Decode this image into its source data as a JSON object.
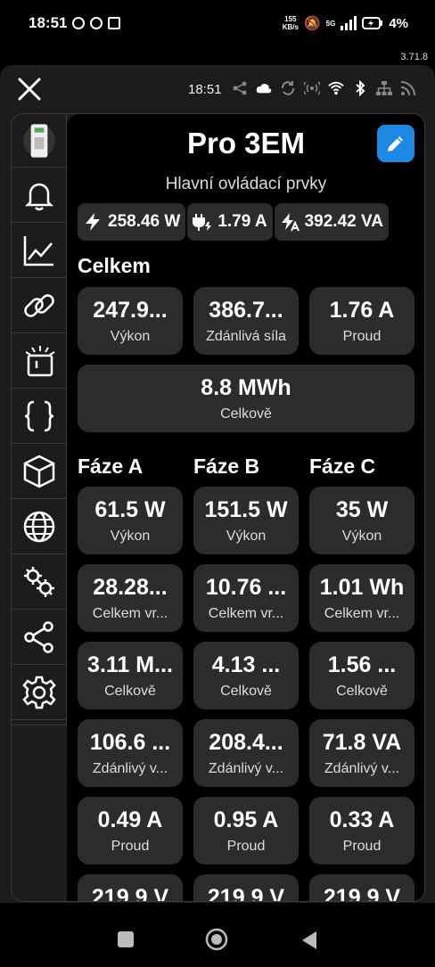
{
  "status": {
    "time": "18:51",
    "net_speed_top": "155",
    "net_speed_bottom": "KB/s",
    "net_type": "5G",
    "battery": "4%"
  },
  "app_version": "3.71.8",
  "topbar": {
    "time": "18:51"
  },
  "device": {
    "title": "Pro 3EM",
    "subtitle": "Hlavní ovládací prvky"
  },
  "chips": [
    {
      "icon": "bolt-icon",
      "value": "258.46 W"
    },
    {
      "icon": "plug-bolt-icon",
      "value": "1.79 A"
    },
    {
      "icon": "bolt-a-icon",
      "value": "392.42 VA"
    }
  ],
  "total": {
    "title": "Celkem",
    "cards": [
      {
        "value": "247.9...",
        "label": "Výkon"
      },
      {
        "value": "386.7...",
        "label": "Zdánlivá síla"
      },
      {
        "value": "1.76 A",
        "label": "Proud"
      }
    ],
    "energy": {
      "value": "8.8 MWh",
      "label": "Celkově"
    }
  },
  "phases": {
    "titles": [
      "Fáze A",
      "Fáze B",
      "Fáze C"
    ],
    "rows": [
      [
        {
          "value": "61.5 W",
          "label": "Výkon"
        },
        {
          "value": "151.5 W",
          "label": "Výkon"
        },
        {
          "value": "35 W",
          "label": "Výkon"
        }
      ],
      [
        {
          "value": "28.28...",
          "label": "Celkem vr..."
        },
        {
          "value": "10.76 ...",
          "label": "Celkem vr..."
        },
        {
          "value": "1.01 Wh",
          "label": "Celkem vr..."
        }
      ],
      [
        {
          "value": "3.11 M...",
          "label": "Celkově"
        },
        {
          "value": "4.13 ...",
          "label": "Celkově"
        },
        {
          "value": "1.56 ...",
          "label": "Celkově"
        }
      ],
      [
        {
          "value": "106.6 ...",
          "label": "Zdánlivý v..."
        },
        {
          "value": "208.4...",
          "label": "Zdánlivý v..."
        },
        {
          "value": "71.8 VA",
          "label": "Zdánlivý v..."
        }
      ],
      [
        {
          "value": "0.49 A",
          "label": "Proud"
        },
        {
          "value": "0.95 A",
          "label": "Proud"
        },
        {
          "value": "0.33 A",
          "label": "Proud"
        }
      ],
      [
        {
          "value": "219.9 V",
          "label": ""
        },
        {
          "value": "219.9 V",
          "label": ""
        },
        {
          "value": "219.9 V",
          "label": ""
        }
      ]
    ]
  },
  "colors": {
    "accent": "#1e88e5",
    "card": "#2c2c2e",
    "background": "#000000",
    "panel": "#1c1c1e"
  }
}
